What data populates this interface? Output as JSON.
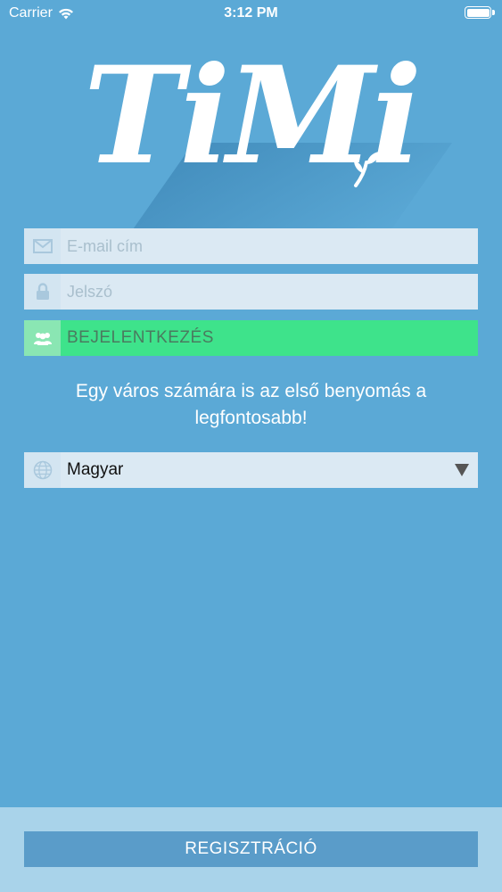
{
  "status_bar": {
    "carrier": "Carrier",
    "time": "3:12 PM"
  },
  "logo": {
    "text": "TiMi",
    "icon": "leaf-icon"
  },
  "login_form": {
    "email": {
      "placeholder": "E-mail cím",
      "value": "",
      "icon": "envelope-icon"
    },
    "password": {
      "placeholder": "Jelszó",
      "value": "",
      "icon": "lock-icon"
    },
    "login_button": {
      "label": "BEJELENTKEZÉS",
      "icon": "users-icon"
    }
  },
  "tagline": "Egy város számára is az első benyomás a legfontosabb!",
  "language_select": {
    "selected": "Magyar",
    "icon": "globe-icon"
  },
  "footer": {
    "register_label": "REGISZTRÁCIÓ"
  },
  "colors": {
    "background": "#5ba9d6",
    "input_bg": "#dbe9f3",
    "login_green": "#3ee38b",
    "footer_bg": "#a9d3ea",
    "register_bg": "#5a9cc9"
  }
}
